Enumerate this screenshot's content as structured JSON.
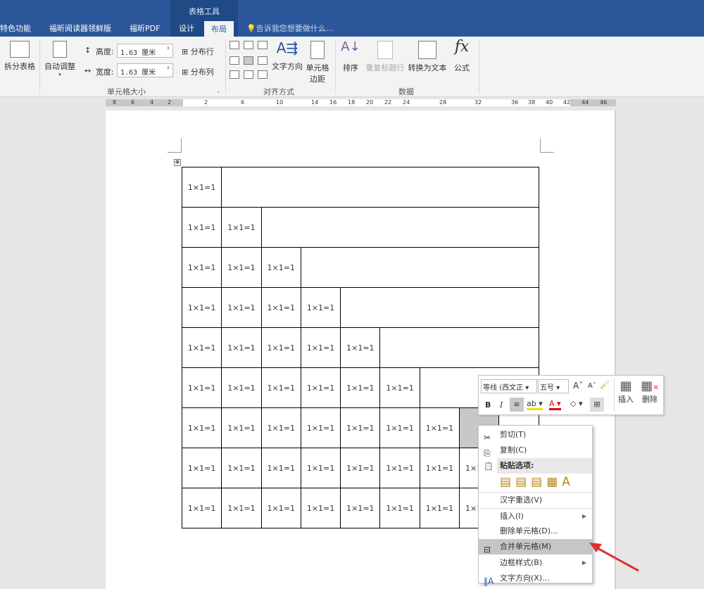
{
  "ribbon": {
    "context_title": "表格工具",
    "tabs": [
      "特色功能",
      "福昕阅读器领鲜版",
      "福昕PDF",
      "设计",
      "布局"
    ],
    "tell_me": "告诉我您想要做什么...",
    "split_table": "拆分表格",
    "autofit": "自动调整",
    "height_label": "高度:",
    "height_value": "1.63 厘米",
    "width_label": "宽度:",
    "width_value": "1.63 厘米",
    "distribute_rows": "分布行",
    "distribute_cols": "分布列",
    "group_cell_size": "单元格大小",
    "text_direction": "文字方向",
    "cell_margins_1": "单元格",
    "cell_margins_2": "边距",
    "group_alignment": "对齐方式",
    "sort": "排序",
    "repeat_header": "重复标题行",
    "convert_to_text": "转换为文本",
    "formula": "公式",
    "group_data": "数据"
  },
  "ruler": {
    "ticks": [
      "8",
      "6",
      "4",
      "2",
      "2",
      "6",
      "10",
      "14",
      "16",
      "18",
      "20",
      "22",
      "24",
      "28",
      "32",
      "36",
      "38",
      "40",
      "42",
      "44",
      "46"
    ]
  },
  "table": {
    "cell_text": "1×1=1",
    "truncated_text": "1×",
    "rows": [
      1,
      2,
      3,
      4,
      5,
      6,
      7,
      8,
      8
    ],
    "columns": 9
  },
  "mini_toolbar": {
    "font": "等线 (西文正",
    "size": "五号",
    "bold": "B",
    "italic": "I",
    "insert": "插入",
    "delete": "删除"
  },
  "context_menu": {
    "cut": "剪切(T)",
    "copy": "复制(C)",
    "paste_options": "粘贴选项:",
    "reconvert": "汉字重选(V)",
    "insert": "插入(I)",
    "delete_cells": "删除单元格(D)...",
    "merge_cells": "合并单元格(M)",
    "border_styles": "边框样式(B)",
    "text_direction": "文字方向(X)..."
  }
}
